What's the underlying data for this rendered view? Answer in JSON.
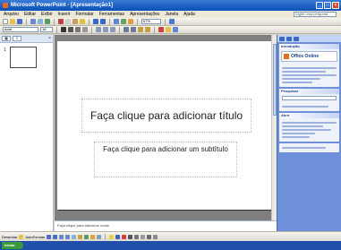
{
  "window": {
    "title": "Microsoft PowerPoint - [Apresentação1]",
    "controls": [
      "_",
      "□",
      "×"
    ]
  },
  "menu": {
    "items": [
      "Arquivo",
      "Editar",
      "Exibir",
      "Inserir",
      "Formatar",
      "Ferramentas",
      "Apresentações",
      "Janela",
      "Ajuda"
    ],
    "help_placeholder": "Digite uma pergunta"
  },
  "toolbar": {
    "font": "Arial",
    "size": "18",
    "zoom": "67%"
  },
  "left_pane": {
    "tabs": [
      "▦",
      "≡"
    ],
    "close": "×",
    "slide_number": "1"
  },
  "slide": {
    "title_placeholder": "Faça clique para adicionar título",
    "subtitle_placeholder": "Faça clique para adicionar um subtítulo"
  },
  "notes": {
    "placeholder": "Faça clique para adicionar notas"
  },
  "task_pane": {
    "title": "Introdução",
    "logo_text": "Office Online",
    "section_search": "Pesquisar",
    "section_open": "Abrir"
  },
  "drawbar": {
    "draw_label": "Desenhar",
    "autoshapes_label": "AutoFormas"
  },
  "status": {
    "start": "iniciar"
  }
}
